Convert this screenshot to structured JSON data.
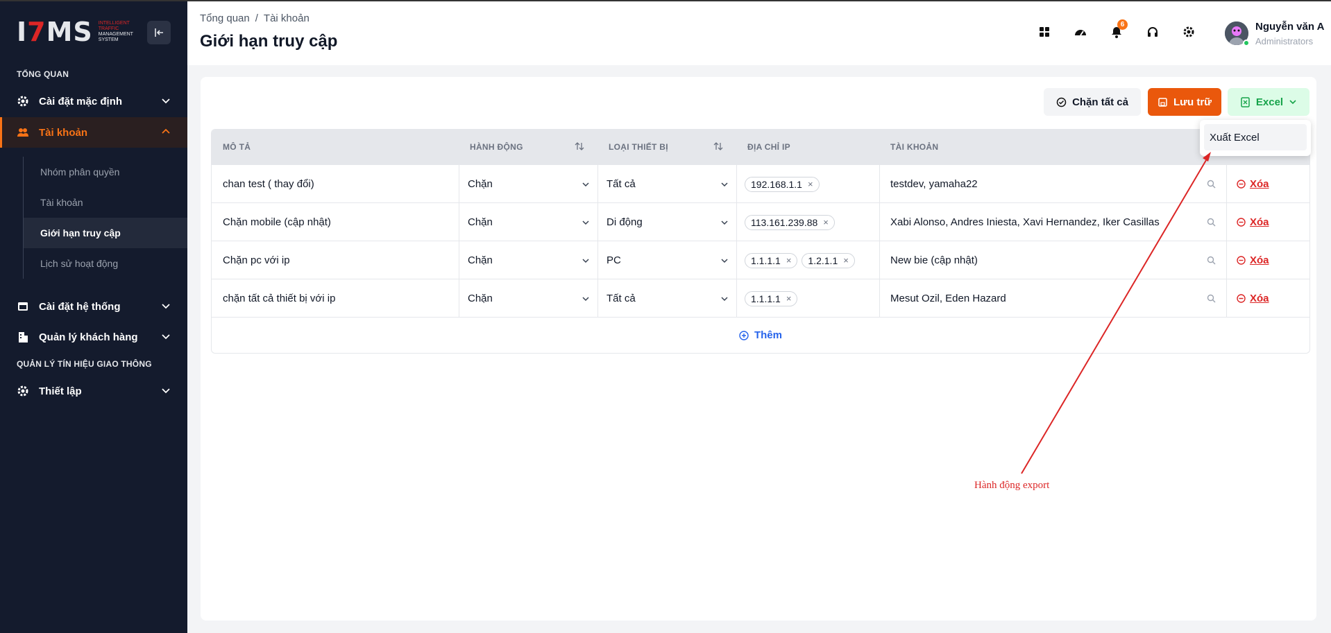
{
  "logo": {
    "main": "ITMS",
    "sub1": "INTELLIGENT",
    "sub2": "TRAFFIC",
    "sub3": "MANAGEMENT",
    "sub4": "SYSTEM"
  },
  "sidebar": {
    "section_overview": "TỔNG QUAN",
    "section_traffic": "QUẢN LÝ TÍN HIỆU GIAO THÔNG",
    "items": [
      {
        "label": "Cài đặt mặc định",
        "icon": "gear-icon"
      },
      {
        "label": "Tài khoản",
        "icon": "users-icon"
      },
      {
        "label": "Cài đặt hệ thống",
        "icon": "window-icon"
      },
      {
        "label": "Quản lý khách hàng",
        "icon": "building-icon"
      },
      {
        "label": "Thiết lập",
        "icon": "gear-icon"
      }
    ],
    "subitems": [
      "Nhóm phân quyền",
      "Tài khoản",
      "Giới hạn truy cập",
      "Lịch sử hoạt động"
    ]
  },
  "header": {
    "breadcrumb": [
      "Tổng quan",
      "/",
      "Tài khoản"
    ],
    "title": "Giới hạn truy cập",
    "notification_count": "6",
    "user_name": "Nguyễn văn A",
    "user_role": "Administrators"
  },
  "toolbar": {
    "block_all": "Chặn tất cả",
    "save": "Lưu trữ",
    "excel": "Excel",
    "export_excel": "Xuất Excel"
  },
  "table": {
    "headers": [
      "MÔ TẢ",
      "HÀNH ĐỘNG",
      "LOẠI THIẾT BỊ",
      "ĐỊA CHỈ IP",
      "TÀI KHOẢN"
    ],
    "rows": [
      {
        "desc": "chan test ( thay đổi)",
        "action": "Chặn",
        "device": "Tất cả",
        "ips": [
          "192.168.1.1"
        ],
        "accounts": "testdev, yamaha22"
      },
      {
        "desc": "Chặn mobile (cập nhật)",
        "action": "Chặn",
        "device": "Di động",
        "ips": [
          "113.161.239.88"
        ],
        "accounts": "Xabi Alonso, Andres Iniesta, Xavi Hernandez, Iker Casillas"
      },
      {
        "desc": "Chặn pc với ip",
        "action": "Chặn",
        "device": "PC",
        "ips": [
          "1.1.1.1",
          "1.2.1.1"
        ],
        "accounts": "New bie (cập nhật)"
      },
      {
        "desc": "chặn tất cả thiết bị với ip",
        "action": "Chặn",
        "device": "Tất cả",
        "ips": [
          "1.1.1.1"
        ],
        "accounts": "Mesut Ozil, Eden Hazard"
      }
    ],
    "delete_label": "Xóa",
    "tag_remove": "×",
    "add_label": "Thêm"
  },
  "annotation": {
    "text": "Hành động export",
    "color": "#dc2626"
  },
  "colors": {
    "accent": "#ea580c",
    "sidebar_bg": "#141b2d",
    "excel_green": "#16a34a"
  }
}
